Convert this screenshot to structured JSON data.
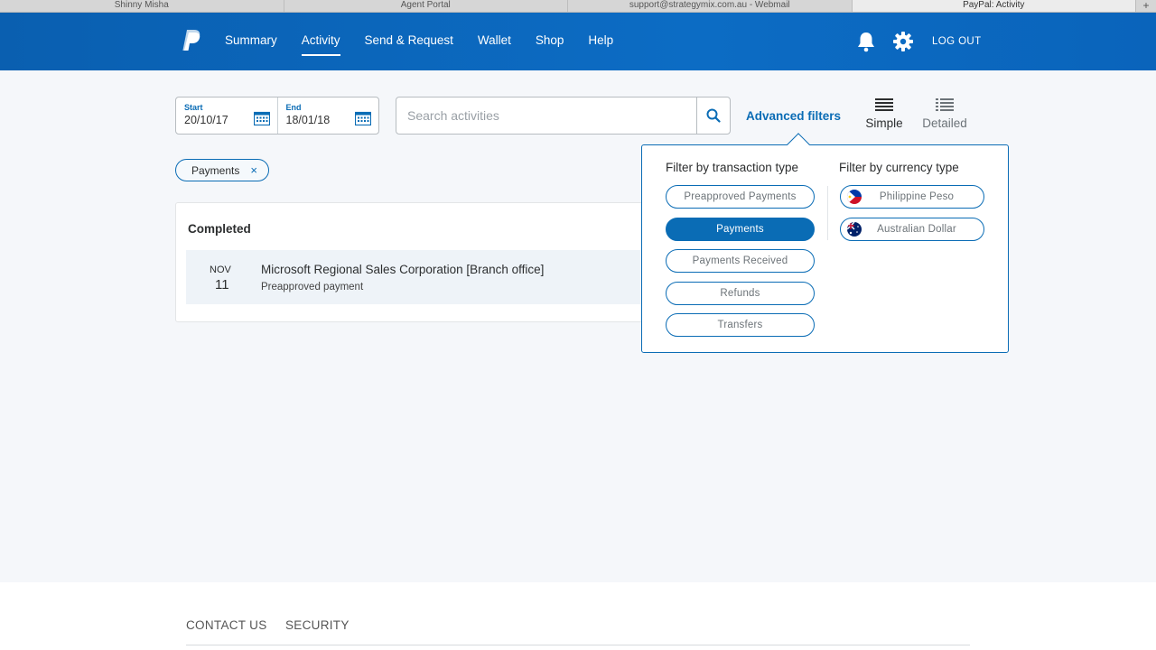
{
  "browser": {
    "tabs": [
      {
        "label": "Shinny Misha"
      },
      {
        "label": "Agent Portal"
      },
      {
        "label": "support@strategymix.com.au - Webmail"
      },
      {
        "label": "PayPal: Activity"
      }
    ],
    "new_tab": "+"
  },
  "header": {
    "nav": [
      {
        "label": "Summary"
      },
      {
        "label": "Activity"
      },
      {
        "label": "Send & Request"
      },
      {
        "label": "Wallet"
      },
      {
        "label": "Shop"
      },
      {
        "label": "Help"
      }
    ],
    "logout": "LOG OUT",
    "icons": [
      "paypal-logo",
      "bell-icon",
      "gear-icon"
    ],
    "brand_color": "#0a6cb5"
  },
  "date_range": {
    "start_label": "Start",
    "start_value": "20/10/17",
    "end_label": "End",
    "end_value": "18/01/18"
  },
  "search": {
    "placeholder": "Search activities"
  },
  "toolbar": {
    "advanced_filters": "Advanced filters",
    "view_simple": "Simple",
    "view_detailed": "Detailed"
  },
  "active_filter": {
    "label": "Payments",
    "remove": "×"
  },
  "results": {
    "section_title": "Completed",
    "transactions": [
      {
        "month": "NOV",
        "day": "11",
        "name": "Microsoft Regional Sales Corporation [Branch office]",
        "type": "Preapproved payment"
      }
    ]
  },
  "filters_popover": {
    "transaction_title": "Filter by transaction type",
    "transaction_types": [
      {
        "label": "Preapproved Payments",
        "selected": false
      },
      {
        "label": "Payments",
        "selected": true
      },
      {
        "label": "Payments Received",
        "selected": false
      },
      {
        "label": "Refunds",
        "selected": false
      },
      {
        "label": "Transfers",
        "selected": false
      }
    ],
    "currency_title": "Filter by currency type",
    "currencies": [
      {
        "label": "Philippine Peso",
        "flag": "philippines-flag-icon"
      },
      {
        "label": "Australian Dollar",
        "flag": "australia-flag-icon"
      }
    ]
  },
  "footer": {
    "links": [
      {
        "label": "CONTACT US"
      },
      {
        "label": "SECURITY"
      }
    ]
  }
}
